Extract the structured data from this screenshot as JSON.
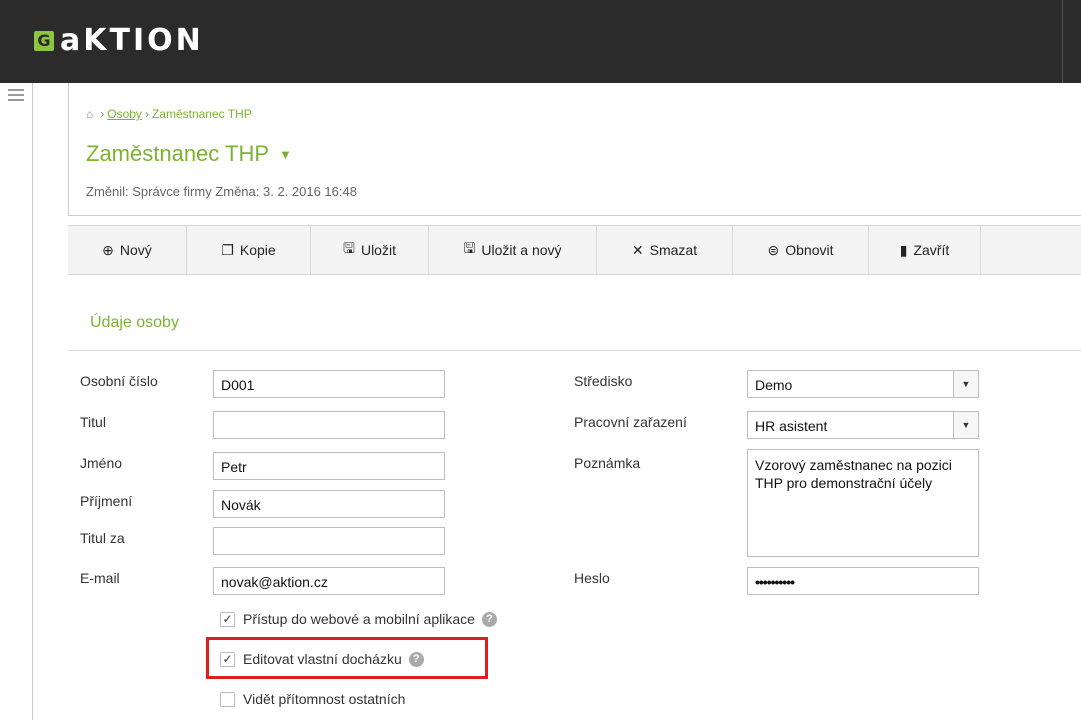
{
  "app": {
    "logo_mark": "G",
    "logo_text": "aKTION"
  },
  "breadcrumb": {
    "home_icon": "home-icon",
    "items": [
      "Osoby",
      "Zaměstnanec THP"
    ]
  },
  "header": {
    "title": "Zaměstnanec THP",
    "changed": "Změnil: Správce firmy Změna: 3. 2. 2016 16:48"
  },
  "toolbar": {
    "buttons": [
      {
        "label": "Nový",
        "icon": "plus-circle-icon"
      },
      {
        "label": "Kopie",
        "icon": "copy-icon"
      },
      {
        "label": "Uložit",
        "icon": "save-icon"
      },
      {
        "label": "Uložit a nový",
        "icon": "save-new-icon"
      },
      {
        "label": "Smazat",
        "icon": "delete-icon"
      },
      {
        "label": "Obnovit",
        "icon": "refresh-icon"
      },
      {
        "label": "Zavřít",
        "icon": "exit-icon"
      }
    ]
  },
  "section": {
    "title": "Údaje osoby"
  },
  "form": {
    "left": [
      {
        "label": "Osobní číslo",
        "value": "D001"
      },
      {
        "label": "Titul",
        "value": ""
      },
      {
        "label": "Jméno",
        "value": "Petr"
      },
      {
        "label": "Příjmení",
        "value": "Novák"
      },
      {
        "label": "Titul za",
        "value": ""
      },
      {
        "label": "E-mail",
        "value": "novak@aktion.cz"
      }
    ],
    "right": {
      "stredisko": {
        "label": "Středisko",
        "value": "Demo"
      },
      "pracovni": {
        "label": "Pracovní zařazení",
        "value": "HR asistent"
      },
      "poznamka": {
        "label": "Poznámka",
        "value": "Vzorový zaměstnanec na pozici THP pro demonstrační účely"
      },
      "heslo": {
        "label": "Heslo",
        "value": "••••••••••"
      }
    },
    "checkboxes": [
      {
        "label": "Přístup do webové a mobilní aplikace",
        "checked": true,
        "help": "?"
      },
      {
        "label": "Editovat vlastní docházku",
        "checked": true,
        "help": "?"
      },
      {
        "label": "Vidět přítomnost ostatních",
        "checked": false
      }
    ]
  },
  "colors": {
    "accent": "#7bb331",
    "topbar": "#2b2b2b",
    "highlight": "#e01e1e"
  }
}
